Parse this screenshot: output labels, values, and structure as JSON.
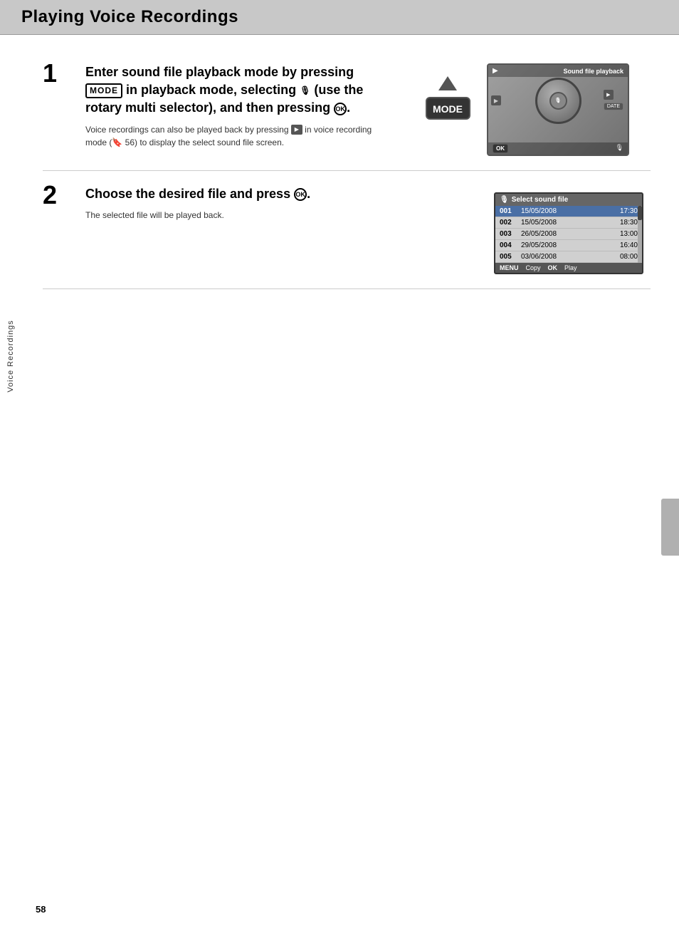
{
  "page": {
    "title": "Playing Voice Recordings",
    "page_number": "58",
    "side_label": "Voice Recordings"
  },
  "steps": [
    {
      "number": "1",
      "title_parts": [
        "Enter sound file playback mode by pressing ",
        "MODE",
        " in playback mode, selecting ",
        "🎙",
        " (use the rotary multi selector), and then pressing ",
        "OK",
        "."
      ],
      "title_text": "Enter sound file playback mode by pressing MODE in playback mode, selecting (use the rotary multi selector), and then pressing OK.",
      "desc": "Voice recordings can also be played back by pressing ▶ in voice recording mode (🔖 56) to display the select sound file screen.",
      "screen1_title": "Sound file playback"
    },
    {
      "number": "2",
      "title_text": "Choose the desired file and press OK.",
      "desc": "The selected file will be played back.",
      "select_title": "Select sound file",
      "files": [
        {
          "num": "001",
          "date": "15/05/2008",
          "time": "17:30",
          "selected": true
        },
        {
          "num": "002",
          "date": "15/05/2008",
          "time": "18:30",
          "selected": false
        },
        {
          "num": "003",
          "date": "26/05/2008",
          "time": "13:00",
          "selected": false
        },
        {
          "num": "004",
          "date": "29/05/2008",
          "time": "16:40",
          "selected": false
        },
        {
          "num": "005",
          "date": "03/06/2008",
          "time": "08:00",
          "selected": false
        }
      ],
      "footer_menu": "MENU Copy",
      "footer_ok": "OK Play"
    }
  ]
}
